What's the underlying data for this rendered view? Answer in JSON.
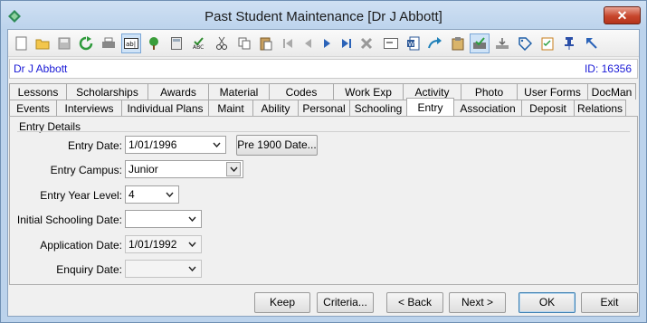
{
  "window": {
    "title": "Past Student Maintenance  [Dr J Abbott]",
    "close_label": "✕"
  },
  "toolbar": {
    "icons": [
      "new-icon",
      "open-icon",
      "save-icon",
      "refresh-icon",
      "print-icon",
      "text-field-icon",
      "tree-icon",
      "calculator-icon",
      "spellcheck-icon",
      "cut-icon",
      "copy-icon",
      "paste-icon",
      "first-record-icon",
      "previous-record-icon",
      "next-record-icon",
      "last-record-icon",
      "delete-icon",
      "card-icon",
      "word-icon",
      "forward-icon",
      "clipboard-icon",
      "checked-icon",
      "download-icon",
      "tag-icon",
      "checklist-icon",
      "pin-icon",
      "arrow-up-left-icon"
    ]
  },
  "student": {
    "name": "Dr J Abbott",
    "id_label": "ID: 16356"
  },
  "tabs_row1": [
    "Lessons",
    "Scholarships",
    "Awards",
    "Material",
    "Codes",
    "Work Exp",
    "Activity",
    "Photo",
    "User Forms",
    "DocMan"
  ],
  "tabs_row2": [
    "Events",
    "Interviews",
    "Individual Plans",
    "Maint",
    "Ability",
    "Personal",
    "Schooling",
    "Entry",
    "Association",
    "Deposit",
    "Relations"
  ],
  "active_tab": "Entry",
  "entry": {
    "section_title": "Entry Details",
    "entry_date_label": "Entry Date:",
    "entry_date_value": "1/01/1996",
    "pre1900_button": "Pre 1900 Date...",
    "entry_campus_label": "Entry Campus:",
    "entry_campus_value": "Junior",
    "entry_year_label": "Entry Year Level:",
    "entry_year_value": "4",
    "initial_schooling_label": "Initial Schooling Date:",
    "initial_schooling_value": "",
    "application_label": "Application Date:",
    "application_value": "1/01/1992",
    "enquiry_label": "Enquiry Date:",
    "enquiry_value": ""
  },
  "buttons": {
    "keep": "Keep",
    "criteria": "Criteria...",
    "back": "< Back",
    "next": "Next >",
    "ok": "OK",
    "exit": "Exit"
  },
  "colors": {
    "accent_text": "#1a1ad6",
    "title_bar": "#bcd3ec",
    "close": "#c7462c"
  }
}
